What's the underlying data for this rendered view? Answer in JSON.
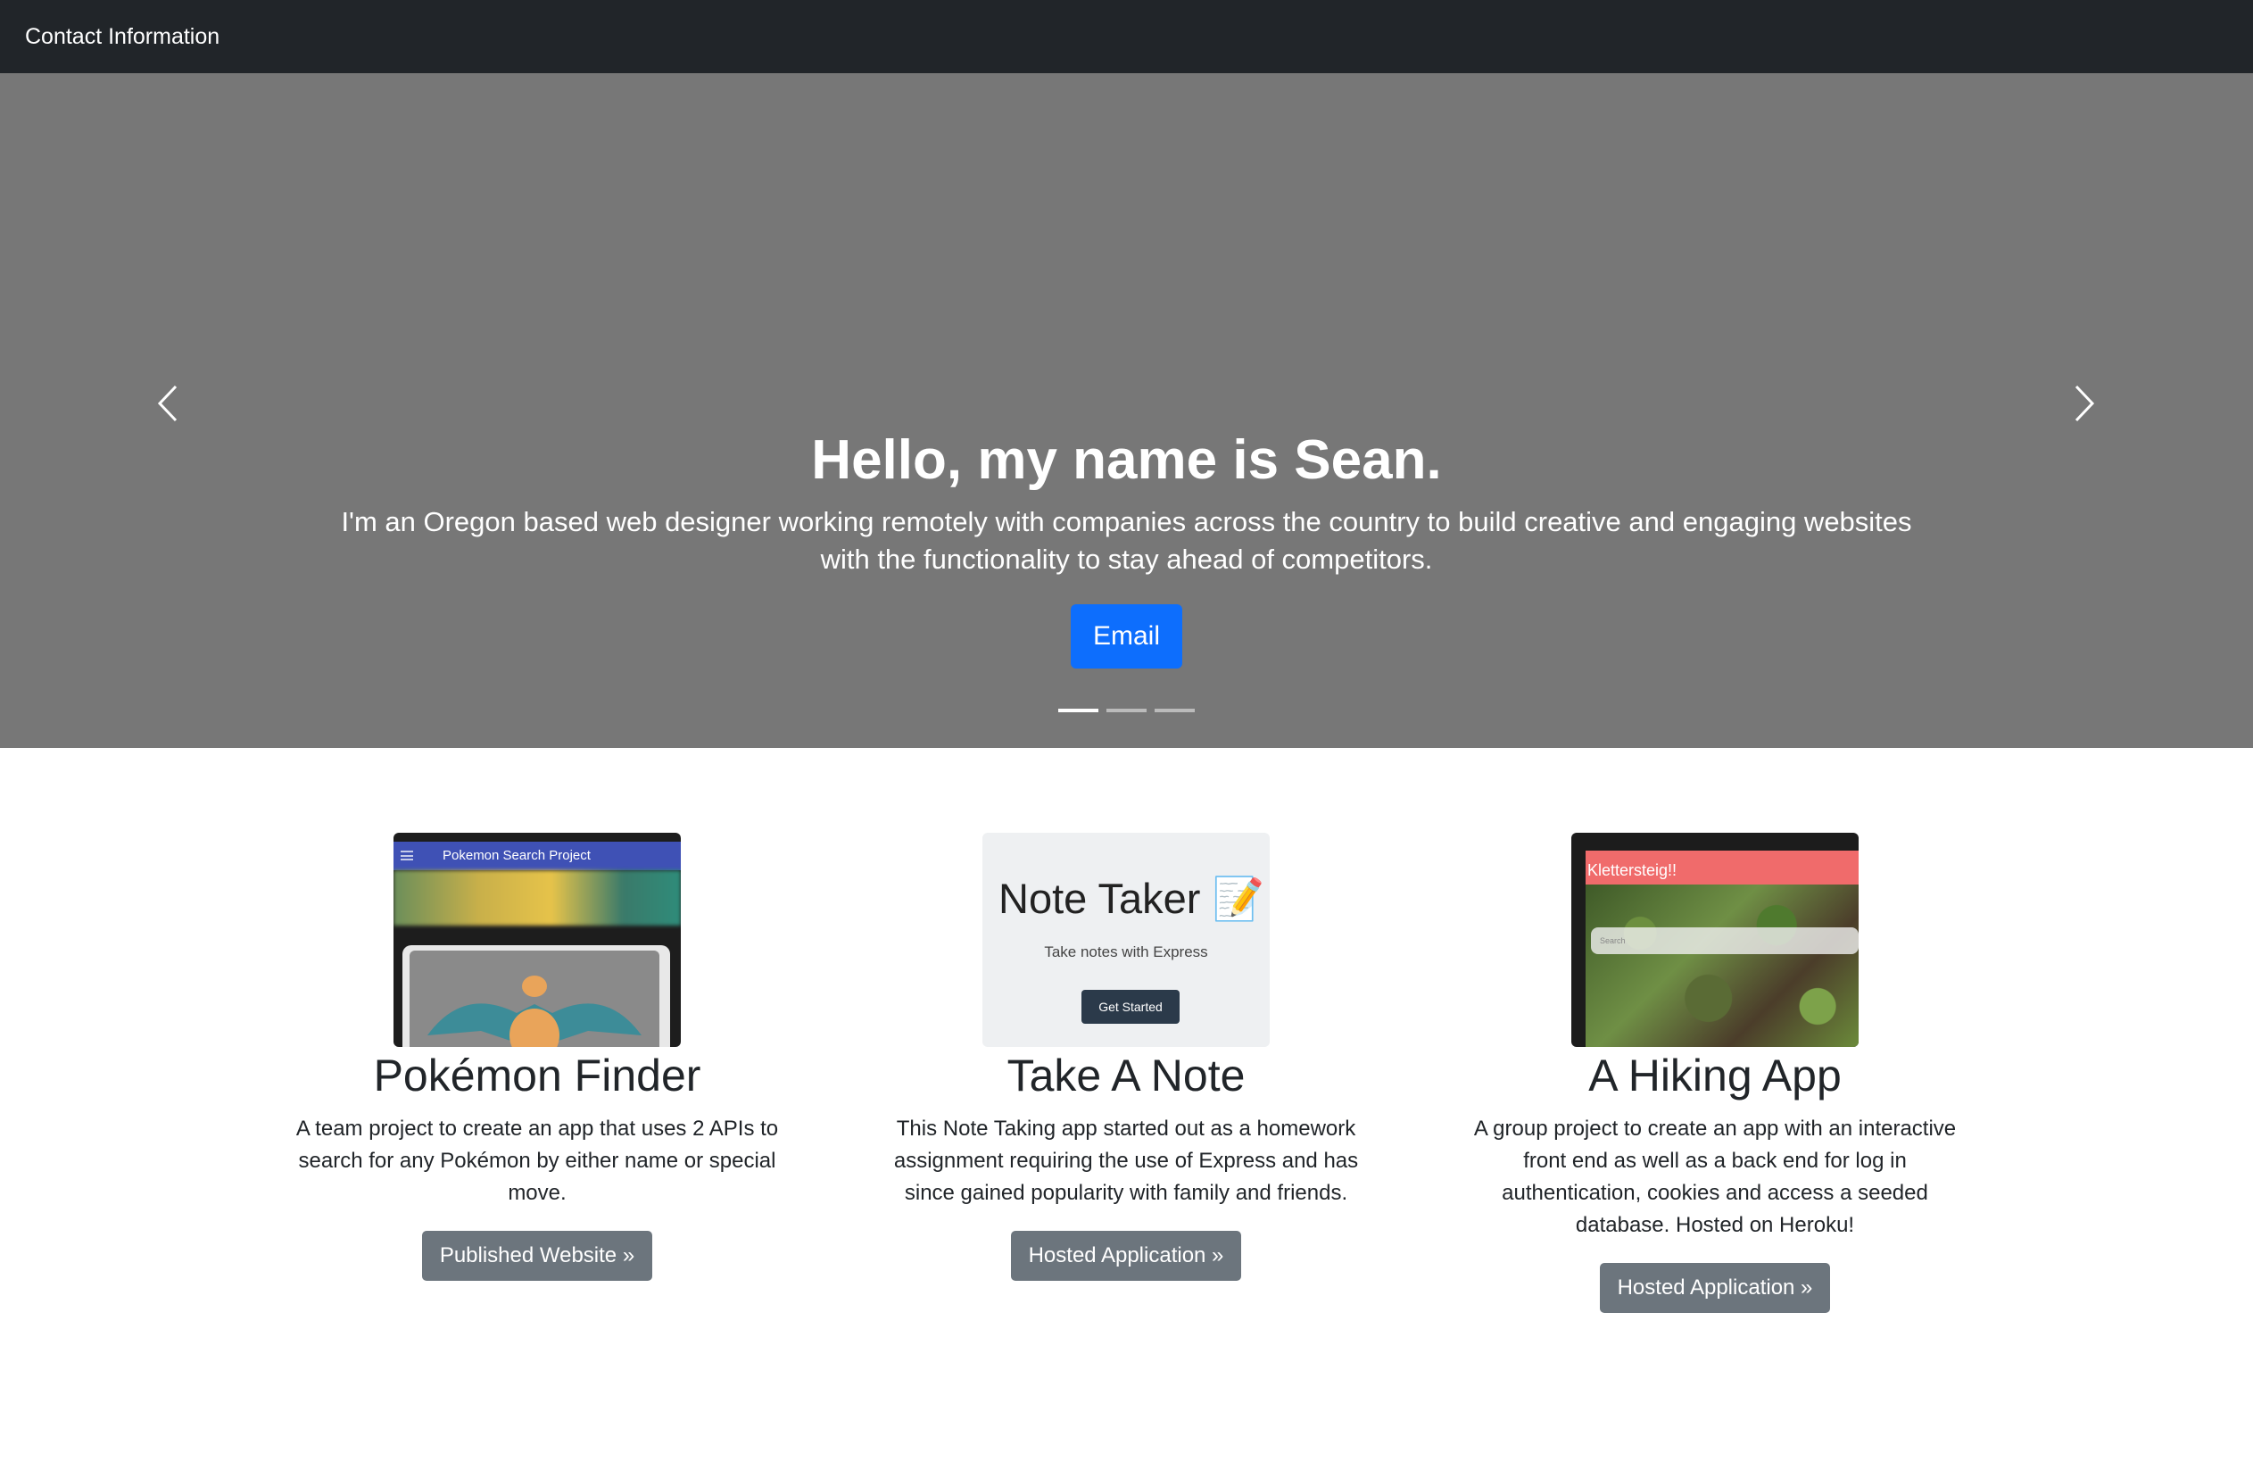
{
  "navbar": {
    "brand": "Contact Information"
  },
  "hero": {
    "heading": "Hello, my name is Sean.",
    "lead": "I'm an Oregon based web designer working remotely with companies across the country to build creative and engaging websites with the functionality to stay ahead of competitors.",
    "button_label": "Email",
    "prev_icon": "chevron-left-icon",
    "next_icon": "chevron-right-icon",
    "slide_count": 3,
    "active_slide": 1
  },
  "projects": [
    {
      "title": "Pokémon Finder",
      "description": "A team project to create an app that uses 2 APIs to search for any Pokémon by either name or special move.",
      "button_label": "Published Website »",
      "thumbnail": {
        "header_text": "Pokemon Search Project"
      }
    },
    {
      "title": "Take A Note",
      "description": "This Note Taking app started out as a homework assignment requiring the use of Express and has since gained popularity with family and friends.",
      "button_label": "Hosted Application »",
      "thumbnail": {
        "title": "Note Taker 📝",
        "subtitle": "Take notes with Express",
        "button_label": "Get Started"
      }
    },
    {
      "title": "A Hiking App",
      "description": "A group project to create an app with an interactive front end as well as a back end for log in authentication, cookies and access a seeded database. Hosted on Heroku!",
      "button_label": "Hosted Application »",
      "thumbnail": {
        "header_text": "Klettersteig!!",
        "search_placeholder": "Search"
      }
    }
  ],
  "colors": {
    "navbar_bg": "#212529",
    "hero_bg": "#777777",
    "primary": "#0d6efd",
    "secondary": "#6c757d"
  }
}
